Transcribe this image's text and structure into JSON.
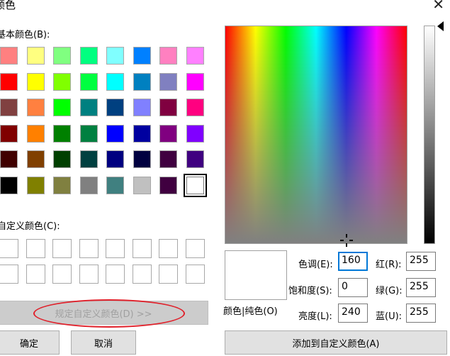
{
  "window": {
    "title": "颜色",
    "close_glyph": "✕"
  },
  "basic": {
    "label": "基本颜色(B):",
    "colors": [
      [
        "#ff8080",
        "#ffff80",
        "#80ff80",
        "#00ff80",
        "#80ffff",
        "#0080ff",
        "#ff80c0",
        "#ff80ff"
      ],
      [
        "#ff0000",
        "#ffff00",
        "#80ff00",
        "#00ff40",
        "#00ffff",
        "#0080c0",
        "#8080c0",
        "#ff00ff"
      ],
      [
        "#804040",
        "#ff8040",
        "#00ff00",
        "#008080",
        "#004080",
        "#8080ff",
        "#800040",
        "#ff0080"
      ],
      [
        "#800000",
        "#ff8000",
        "#008000",
        "#008040",
        "#0000ff",
        "#0000a0",
        "#800080",
        "#8000ff"
      ],
      [
        "#400000",
        "#804000",
        "#004000",
        "#004040",
        "#000080",
        "#000040",
        "#400040",
        "#400080"
      ],
      [
        "#000000",
        "#808000",
        "#808040",
        "#808080",
        "#408080",
        "#c0c0c0",
        "#400040",
        "#ffffff"
      ]
    ],
    "selected": {
      "row": 5,
      "col": 7
    }
  },
  "custom": {
    "label": "自定义颜色(C):",
    "rows": 2,
    "cols": 8
  },
  "buttons": {
    "define": "规定自定义颜色(D) >>",
    "ok": "确定",
    "cancel": "取消",
    "add": "添加到自定义颜色(A)"
  },
  "fields": {
    "hue": {
      "label": "色调(E):",
      "value": "160"
    },
    "sat": {
      "label": "饱和度(S):",
      "value": "0"
    },
    "lum": {
      "label": "亮度(L):",
      "value": "240"
    },
    "red": {
      "label": "红(R):",
      "value": "255"
    },
    "green": {
      "label": "绿(G):",
      "value": "255"
    },
    "blue": {
      "label": "蓝(U):",
      "value": "255"
    }
  },
  "solid_label": "颜色|纯色(O)",
  "accent": "#0078d7",
  "annotation_color": "#e0202a"
}
